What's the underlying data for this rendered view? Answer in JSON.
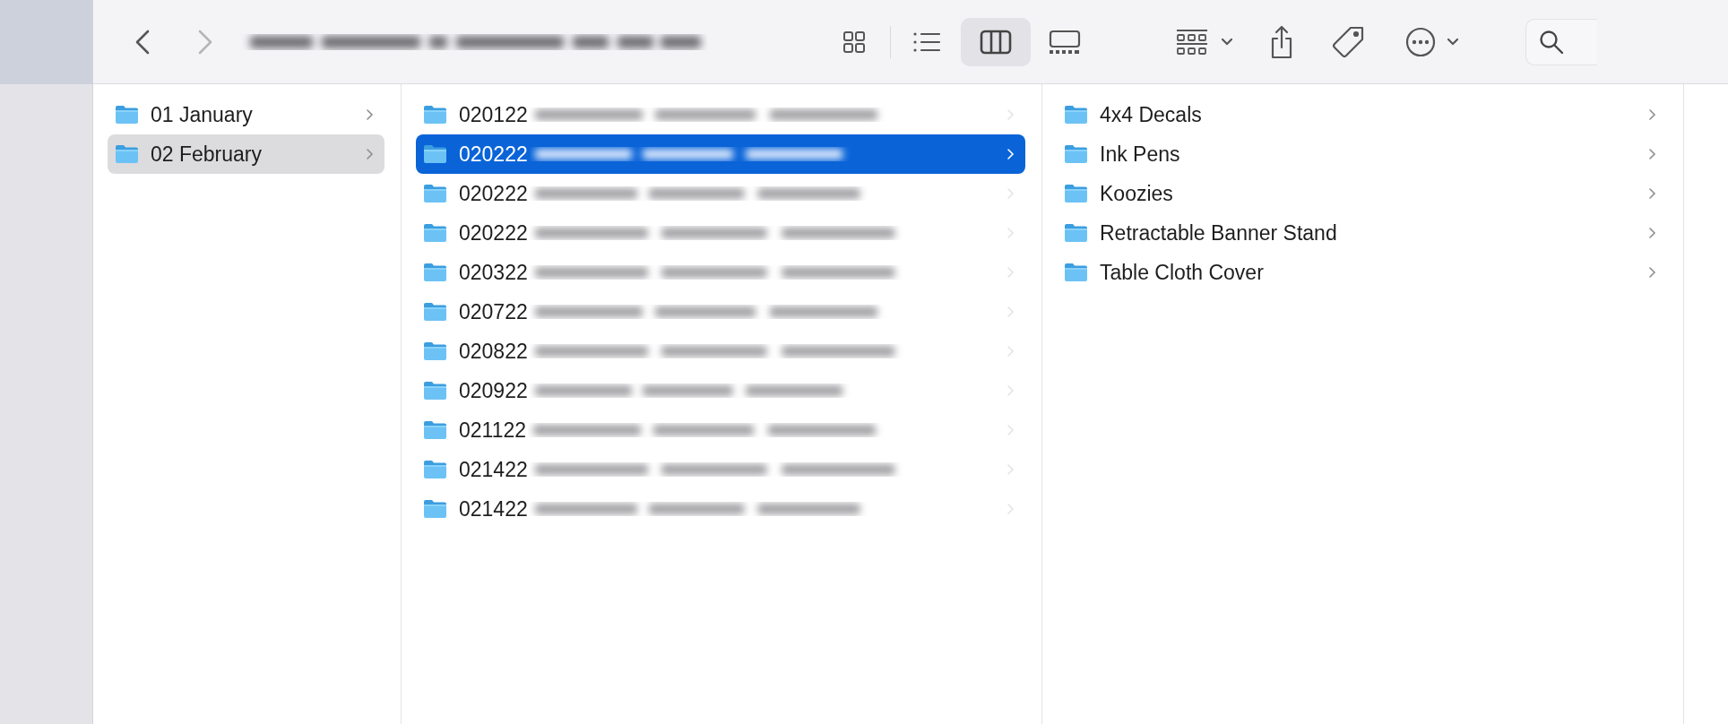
{
  "toolbar": {
    "title_redacted": true,
    "views": [
      {
        "kind": "icons",
        "selected": false
      },
      {
        "kind": "list",
        "selected": false
      },
      {
        "kind": "columns",
        "selected": true
      },
      {
        "kind": "gallery",
        "selected": false
      }
    ]
  },
  "columns": [
    {
      "items": [
        {
          "name": "01 January",
          "selected": false,
          "redacted": false
        },
        {
          "name": "02 February",
          "selected": true,
          "focused": false,
          "redacted": false
        }
      ]
    },
    {
      "items": [
        {
          "name": "020122",
          "selected": false,
          "redacted": true
        },
        {
          "name": "020222",
          "selected": true,
          "focused": true,
          "redacted": true
        },
        {
          "name": "020222",
          "selected": false,
          "redacted": true
        },
        {
          "name": "020222",
          "selected": false,
          "redacted": true
        },
        {
          "name": "020322",
          "selected": false,
          "redacted": true
        },
        {
          "name": "020722",
          "selected": false,
          "redacted": true
        },
        {
          "name": "020822",
          "selected": false,
          "redacted": true
        },
        {
          "name": "020922",
          "selected": false,
          "redacted": true
        },
        {
          "name": "021122",
          "selected": false,
          "redacted": true
        },
        {
          "name": "021422",
          "selected": false,
          "redacted": true
        },
        {
          "name": "021422",
          "selected": false,
          "redacted": true
        }
      ]
    },
    {
      "items": [
        {
          "name": "4x4 Decals",
          "selected": false,
          "redacted": false
        },
        {
          "name": "Ink Pens",
          "selected": false,
          "redacted": false
        },
        {
          "name": "Koozies",
          "selected": false,
          "redacted": false
        },
        {
          "name": "Retractable Banner Stand",
          "selected": false,
          "redacted": false
        },
        {
          "name": "Table Cloth Cover",
          "selected": false,
          "redacted": false
        }
      ]
    }
  ]
}
